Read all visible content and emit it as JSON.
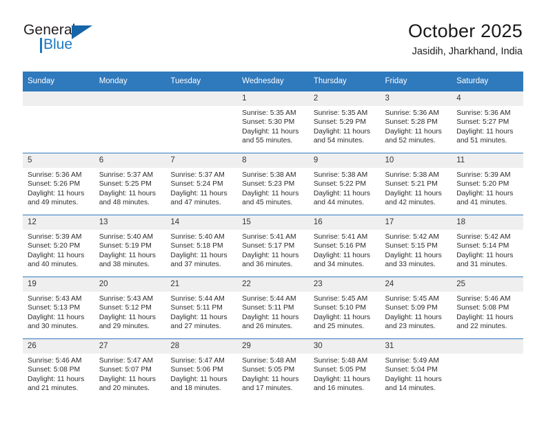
{
  "brand": {
    "name_part1": "General",
    "name_part2": "Blue",
    "accent_color": "#1b78c2",
    "logo_triangle_color": "#1565a8"
  },
  "header": {
    "title": "October 2025",
    "subtitle": "Jasidih, Jharkhand, India"
  },
  "calendar": {
    "header_bg": "#2f79bd",
    "daynum_bg": "#efefef",
    "weekdays": [
      "Sunday",
      "Monday",
      "Tuesday",
      "Wednesday",
      "Thursday",
      "Friday",
      "Saturday"
    ],
    "labels": {
      "sunrise": "Sunrise:",
      "sunset": "Sunset:",
      "daylight": "Daylight:"
    },
    "weeks": [
      [
        {
          "day": "",
          "empty": true
        },
        {
          "day": "",
          "empty": true
        },
        {
          "day": "",
          "empty": true
        },
        {
          "day": "1",
          "sunrise": "Sunrise: 5:35 AM",
          "sunset": "Sunset: 5:30 PM",
          "daylight": "Daylight: 11 hours and 55 minutes."
        },
        {
          "day": "2",
          "sunrise": "Sunrise: 5:35 AM",
          "sunset": "Sunset: 5:29 PM",
          "daylight": "Daylight: 11 hours and 54 minutes."
        },
        {
          "day": "3",
          "sunrise": "Sunrise: 5:36 AM",
          "sunset": "Sunset: 5:28 PM",
          "daylight": "Daylight: 11 hours and 52 minutes."
        },
        {
          "day": "4",
          "sunrise": "Sunrise: 5:36 AM",
          "sunset": "Sunset: 5:27 PM",
          "daylight": "Daylight: 11 hours and 51 minutes."
        }
      ],
      [
        {
          "day": "5",
          "sunrise": "Sunrise: 5:36 AM",
          "sunset": "Sunset: 5:26 PM",
          "daylight": "Daylight: 11 hours and 49 minutes."
        },
        {
          "day": "6",
          "sunrise": "Sunrise: 5:37 AM",
          "sunset": "Sunset: 5:25 PM",
          "daylight": "Daylight: 11 hours and 48 minutes."
        },
        {
          "day": "7",
          "sunrise": "Sunrise: 5:37 AM",
          "sunset": "Sunset: 5:24 PM",
          "daylight": "Daylight: 11 hours and 47 minutes."
        },
        {
          "day": "8",
          "sunrise": "Sunrise: 5:38 AM",
          "sunset": "Sunset: 5:23 PM",
          "daylight": "Daylight: 11 hours and 45 minutes."
        },
        {
          "day": "9",
          "sunrise": "Sunrise: 5:38 AM",
          "sunset": "Sunset: 5:22 PM",
          "daylight": "Daylight: 11 hours and 44 minutes."
        },
        {
          "day": "10",
          "sunrise": "Sunrise: 5:38 AM",
          "sunset": "Sunset: 5:21 PM",
          "daylight": "Daylight: 11 hours and 42 minutes."
        },
        {
          "day": "11",
          "sunrise": "Sunrise: 5:39 AM",
          "sunset": "Sunset: 5:20 PM",
          "daylight": "Daylight: 11 hours and 41 minutes."
        }
      ],
      [
        {
          "day": "12",
          "sunrise": "Sunrise: 5:39 AM",
          "sunset": "Sunset: 5:20 PM",
          "daylight": "Daylight: 11 hours and 40 minutes."
        },
        {
          "day": "13",
          "sunrise": "Sunrise: 5:40 AM",
          "sunset": "Sunset: 5:19 PM",
          "daylight": "Daylight: 11 hours and 38 minutes."
        },
        {
          "day": "14",
          "sunrise": "Sunrise: 5:40 AM",
          "sunset": "Sunset: 5:18 PM",
          "daylight": "Daylight: 11 hours and 37 minutes."
        },
        {
          "day": "15",
          "sunrise": "Sunrise: 5:41 AM",
          "sunset": "Sunset: 5:17 PM",
          "daylight": "Daylight: 11 hours and 36 minutes."
        },
        {
          "day": "16",
          "sunrise": "Sunrise: 5:41 AM",
          "sunset": "Sunset: 5:16 PM",
          "daylight": "Daylight: 11 hours and 34 minutes."
        },
        {
          "day": "17",
          "sunrise": "Sunrise: 5:42 AM",
          "sunset": "Sunset: 5:15 PM",
          "daylight": "Daylight: 11 hours and 33 minutes."
        },
        {
          "day": "18",
          "sunrise": "Sunrise: 5:42 AM",
          "sunset": "Sunset: 5:14 PM",
          "daylight": "Daylight: 11 hours and 31 minutes."
        }
      ],
      [
        {
          "day": "19",
          "sunrise": "Sunrise: 5:43 AM",
          "sunset": "Sunset: 5:13 PM",
          "daylight": "Daylight: 11 hours and 30 minutes."
        },
        {
          "day": "20",
          "sunrise": "Sunrise: 5:43 AM",
          "sunset": "Sunset: 5:12 PM",
          "daylight": "Daylight: 11 hours and 29 minutes."
        },
        {
          "day": "21",
          "sunrise": "Sunrise: 5:44 AM",
          "sunset": "Sunset: 5:11 PM",
          "daylight": "Daylight: 11 hours and 27 minutes."
        },
        {
          "day": "22",
          "sunrise": "Sunrise: 5:44 AM",
          "sunset": "Sunset: 5:11 PM",
          "daylight": "Daylight: 11 hours and 26 minutes."
        },
        {
          "day": "23",
          "sunrise": "Sunrise: 5:45 AM",
          "sunset": "Sunset: 5:10 PM",
          "daylight": "Daylight: 11 hours and 25 minutes."
        },
        {
          "day": "24",
          "sunrise": "Sunrise: 5:45 AM",
          "sunset": "Sunset: 5:09 PM",
          "daylight": "Daylight: 11 hours and 23 minutes."
        },
        {
          "day": "25",
          "sunrise": "Sunrise: 5:46 AM",
          "sunset": "Sunset: 5:08 PM",
          "daylight": "Daylight: 11 hours and 22 minutes."
        }
      ],
      [
        {
          "day": "26",
          "sunrise": "Sunrise: 5:46 AM",
          "sunset": "Sunset: 5:08 PM",
          "daylight": "Daylight: 11 hours and 21 minutes."
        },
        {
          "day": "27",
          "sunrise": "Sunrise: 5:47 AM",
          "sunset": "Sunset: 5:07 PM",
          "daylight": "Daylight: 11 hours and 20 minutes."
        },
        {
          "day": "28",
          "sunrise": "Sunrise: 5:47 AM",
          "sunset": "Sunset: 5:06 PM",
          "daylight": "Daylight: 11 hours and 18 minutes."
        },
        {
          "day": "29",
          "sunrise": "Sunrise: 5:48 AM",
          "sunset": "Sunset: 5:05 PM",
          "daylight": "Daylight: 11 hours and 17 minutes."
        },
        {
          "day": "30",
          "sunrise": "Sunrise: 5:48 AM",
          "sunset": "Sunset: 5:05 PM",
          "daylight": "Daylight: 11 hours and 16 minutes."
        },
        {
          "day": "31",
          "sunrise": "Sunrise: 5:49 AM",
          "sunset": "Sunset: 5:04 PM",
          "daylight": "Daylight: 11 hours and 14 minutes."
        },
        {
          "day": "",
          "empty": true
        }
      ]
    ]
  }
}
